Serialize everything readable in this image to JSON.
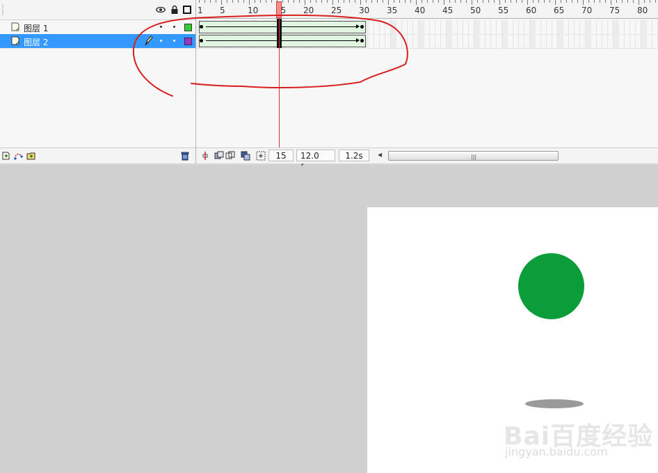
{
  "layers": {
    "header_icons": [
      "eye-icon",
      "lock-icon",
      "outline-icon"
    ],
    "rows": [
      {
        "name": "图层 1",
        "selected": false,
        "outline_color": "#33cc33"
      },
      {
        "name": "图层 2",
        "selected": true,
        "outline_color": "#9933cc"
      }
    ]
  },
  "timeline": {
    "ruler_numbers": [
      "1",
      "5",
      "10",
      "15",
      "20",
      "25",
      "30",
      "35",
      "40",
      "45",
      "50",
      "55",
      "60",
      "65",
      "70",
      "75",
      "80"
    ],
    "current_frame": "15",
    "fps": "12.0 fps",
    "elapsed": "1.2s"
  },
  "stage": {
    "ball_color": "#0b9d3a",
    "shadow_color": "#9a9a9a",
    "watermark_logo": "Bai百度经验",
    "watermark_url": "jingyan.baidu.com"
  },
  "colors": {
    "selection": "#3399ff",
    "playhead": "#e13030",
    "tween_fill": "#dff5e0",
    "annotation_stroke": "#d81e1e"
  }
}
